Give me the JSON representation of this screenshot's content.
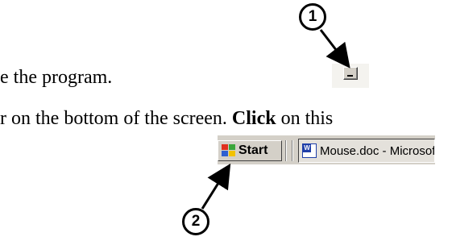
{
  "document": {
    "line1": "e the program.",
    "line2_part1": "r on the bottom of the screen.  ",
    "line2_bold": "Click",
    "line2_part2": " on this"
  },
  "callouts": {
    "one": "1",
    "two": "2"
  },
  "taskbar": {
    "start_label": "Start",
    "task_label": "Mouse.doc - Microsoft Word"
  },
  "icons": {
    "minimize": "minimize-icon",
    "windows_flag": "windows-flag-icon",
    "word_doc": "word-document-icon"
  }
}
